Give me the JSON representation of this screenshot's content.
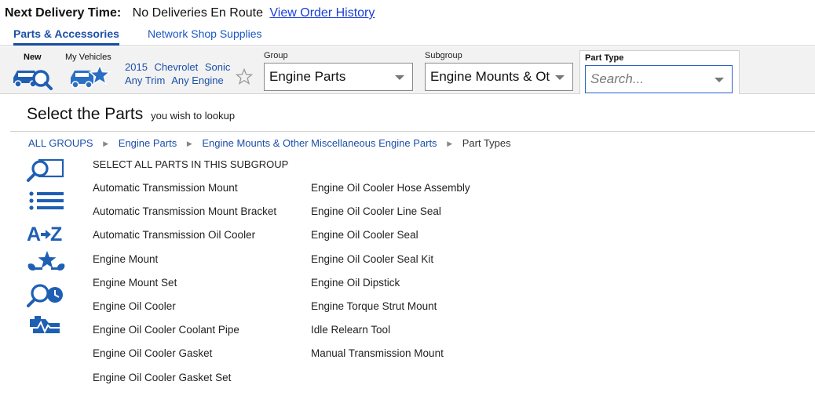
{
  "header": {
    "delivery_label": "Next Delivery Time:",
    "delivery_value": "No Deliveries En Route",
    "history_link": "View Order History"
  },
  "tabs": [
    {
      "label": "Parts & Accessories",
      "active": true
    },
    {
      "label": "Network Shop Supplies",
      "active": false
    }
  ],
  "toolbar": {
    "new_label": "New",
    "my_vehicles_label": "My Vehicles",
    "vehicle": {
      "year": "2015",
      "make": "Chevrolet",
      "model": "Sonic",
      "trim": "Any Trim",
      "engine": "Any Engine"
    },
    "group": {
      "label": "Group",
      "value": "Engine Parts"
    },
    "subgroup": {
      "label": "Subgroup",
      "value": "Engine Mounts & Ot"
    },
    "part_type": {
      "label": "Part Type",
      "placeholder": "Search..."
    }
  },
  "main": {
    "title": "Select the Parts",
    "subtitle": "you wish to lookup",
    "breadcrumb": [
      "ALL GROUPS",
      "Engine Parts",
      "Engine Mounts & Other Miscellaneous Engine Parts"
    ],
    "breadcrumb_current": "Part Types",
    "select_all": "SELECT ALL PARTS IN THIS SUBGROUP",
    "parts_col1": [
      "Automatic Transmission Mount",
      "Automatic Transmission Mount Bracket",
      "Automatic Transmission Oil Cooler",
      "Engine Mount",
      "Engine Mount Set",
      "Engine Oil Cooler",
      "Engine Oil Cooler Coolant Pipe",
      "Engine Oil Cooler Gasket",
      "Engine Oil Cooler Gasket Set"
    ],
    "parts_col2": [
      "Engine Oil Cooler Hose Assembly",
      "Engine Oil Cooler Line Seal",
      "Engine Oil Cooler Seal",
      "Engine Oil Cooler Seal Kit",
      "Engine Oil Dipstick",
      "Engine Torque Strut Mount",
      "Idle Relearn Tool",
      "Manual Transmission Mount"
    ]
  },
  "colors": {
    "accent": "#1b4fa8",
    "link": "#1a3fd6",
    "icon": "#1f5fb3"
  },
  "icons": [
    "new-vehicle-search-icon",
    "my-vehicles-star-icon",
    "star-outline-icon",
    "search-image-icon",
    "list-icon",
    "a-to-z-icon",
    "wrench-star-icon",
    "search-clock-icon",
    "engine-diagnostic-icon"
  ]
}
